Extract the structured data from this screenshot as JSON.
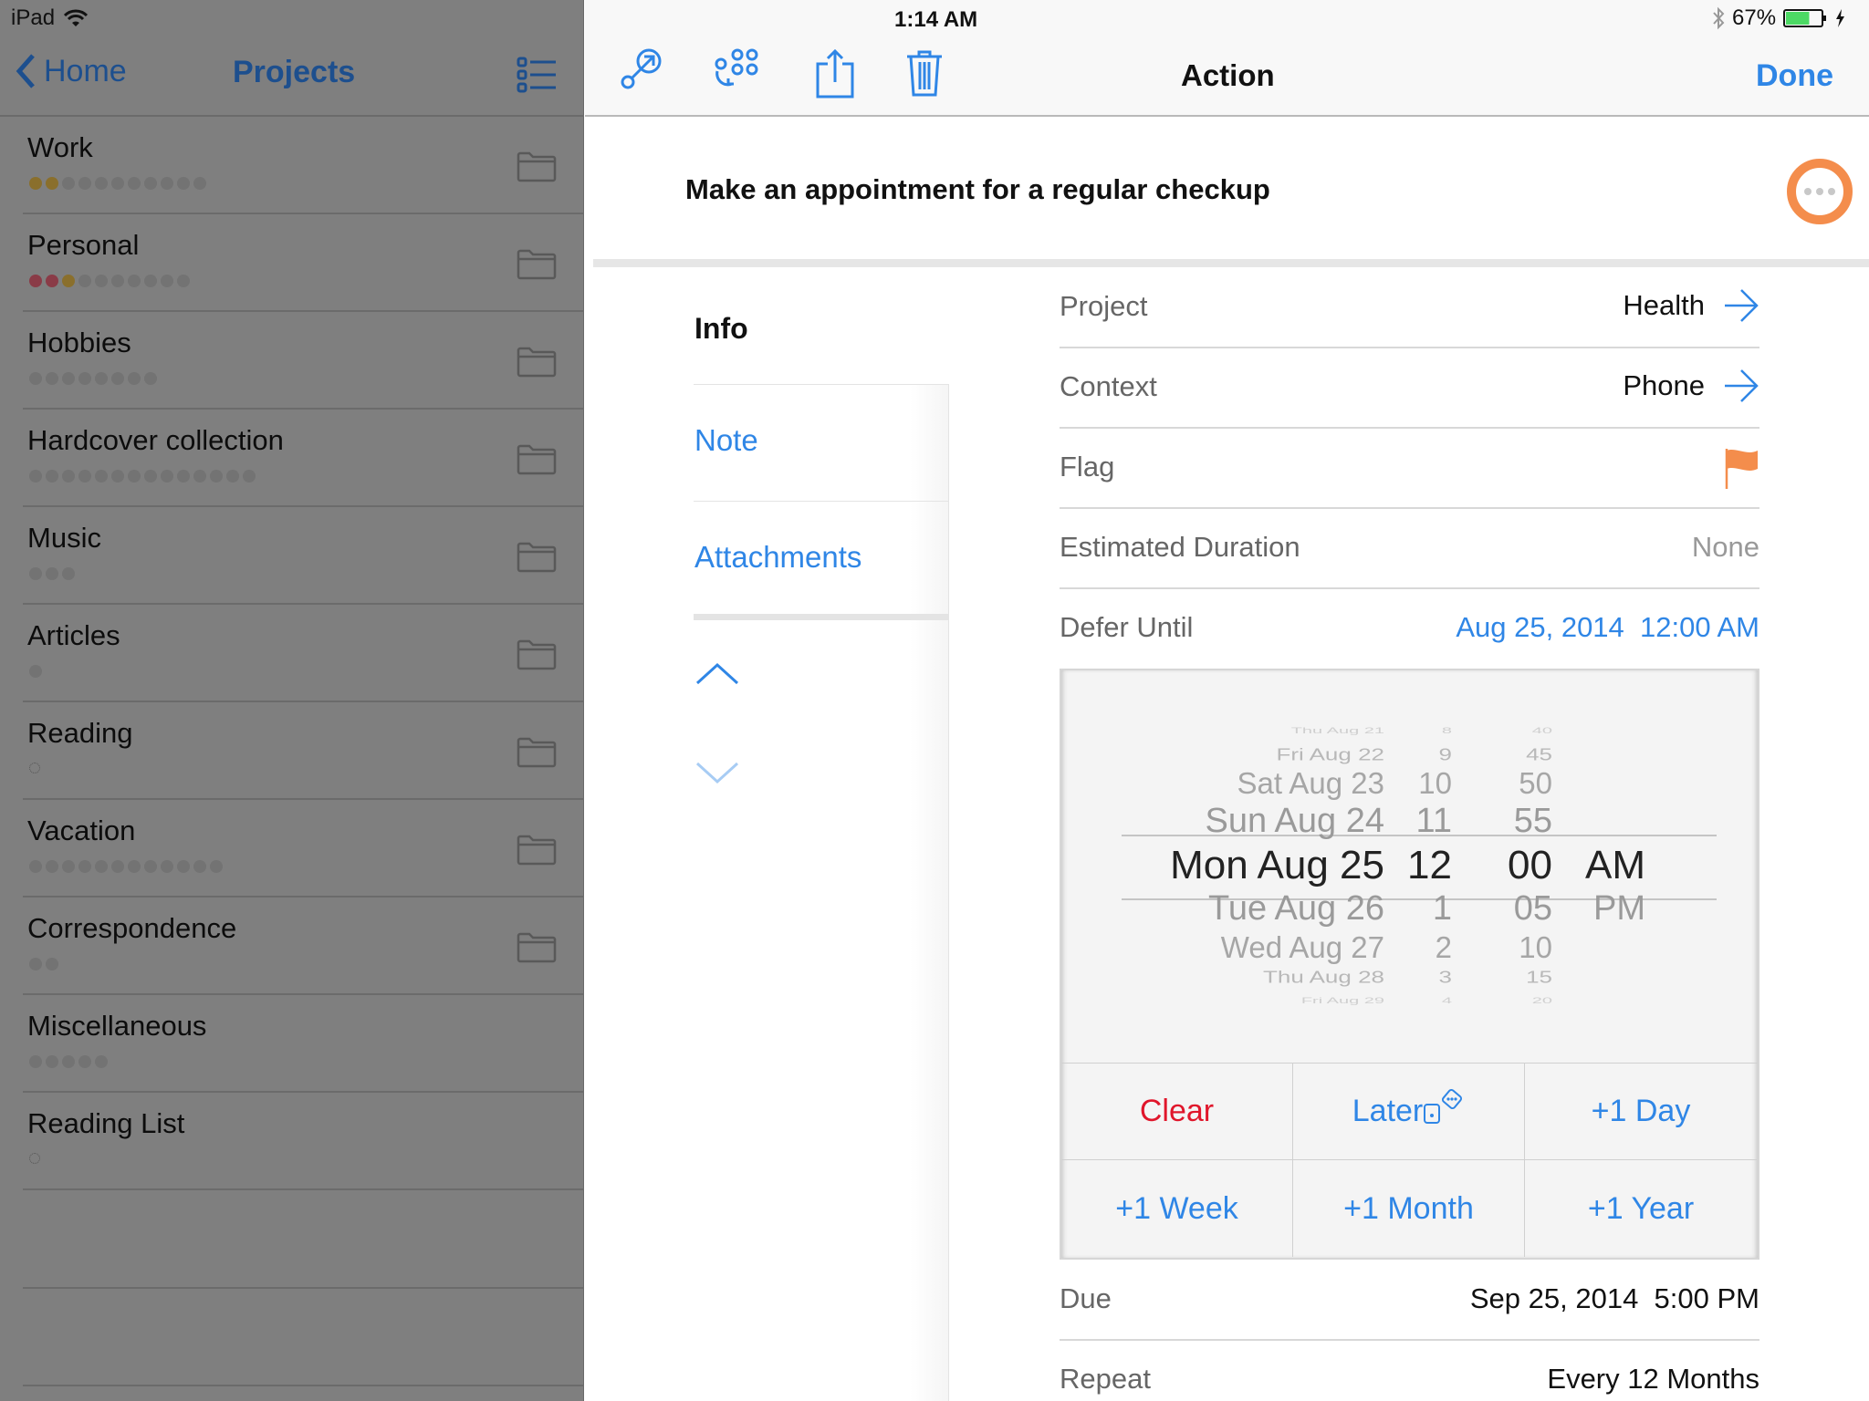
{
  "status_bar": {
    "device": "iPad",
    "time": "1:14 AM",
    "battery": "67%",
    "battery_level": 0.67
  },
  "left_nav": {
    "back_label": "Home",
    "title": "Projects"
  },
  "projects": [
    {
      "name": "Work",
      "dots": [
        "y",
        "y",
        "g",
        "g",
        "g",
        "g",
        "g",
        "g",
        "g",
        "g",
        "g"
      ],
      "folder": true
    },
    {
      "name": "Personal",
      "dots": [
        "r",
        "r",
        "y",
        "g",
        "g",
        "g",
        "g",
        "g",
        "g",
        "g"
      ],
      "folder": true
    },
    {
      "name": "Hobbies",
      "dots": [
        "g",
        "g",
        "g",
        "g",
        "g",
        "g",
        "g",
        "g"
      ],
      "folder": true
    },
    {
      "name": "Hardcover collection",
      "dots": [
        "g",
        "g",
        "g",
        "g",
        "g",
        "g",
        "g",
        "g",
        "g",
        "g",
        "g",
        "g",
        "g",
        "g"
      ],
      "folder": true
    },
    {
      "name": "Music",
      "dots": [
        "g",
        "g",
        "g"
      ],
      "folder": true
    },
    {
      "name": "Articles",
      "dots": [
        "g"
      ],
      "folder": true
    },
    {
      "name": "Reading",
      "dots": [
        "empty"
      ],
      "folder": true
    },
    {
      "name": "Vacation",
      "dots": [
        "g",
        "g",
        "g",
        "g",
        "g",
        "g",
        "g",
        "g",
        "g",
        "g",
        "g",
        "g"
      ],
      "folder": true
    },
    {
      "name": "Correspondence",
      "dots": [
        "g",
        "g"
      ],
      "folder": true
    },
    {
      "name": "Miscellaneous",
      "dots": [
        "g",
        "g",
        "g",
        "g",
        "g"
      ],
      "folder": false
    },
    {
      "name": "Reading List",
      "dots": [
        "empty"
      ],
      "folder": false
    }
  ],
  "toolbar": {
    "title": "Action",
    "done_label": "Done",
    "icons": [
      "focus-icon",
      "group-icon",
      "share-icon",
      "trash-icon"
    ]
  },
  "task": {
    "title": "Make an appointment for a regular checkup"
  },
  "side_tabs": {
    "info": "Info",
    "note": "Note",
    "attachments": "Attachments"
  },
  "fields": {
    "project": {
      "label": "Project",
      "value": "Health"
    },
    "context": {
      "label": "Context",
      "value": "Phone"
    },
    "flag": {
      "label": "Flag",
      "flagged": true
    },
    "duration": {
      "label": "Estimated Duration",
      "value": "None"
    },
    "defer": {
      "label": "Defer Until",
      "value": "Aug 25, 2014  12:00 AM"
    },
    "due": {
      "label": "Due",
      "value": "Sep 25, 2014  5:00 PM"
    },
    "repeat": {
      "label": "Repeat",
      "value": "Every 12 Months"
    }
  },
  "picker": {
    "rows": [
      {
        "date": "Thu Aug 21",
        "hour": "8",
        "minute": "40",
        "ampm": ""
      },
      {
        "date": "Fri Aug 22",
        "hour": "9",
        "minute": "45",
        "ampm": ""
      },
      {
        "date": "Sat Aug 23",
        "hour": "10",
        "minute": "50",
        "ampm": ""
      },
      {
        "date": "Sun Aug 24",
        "hour": "11",
        "minute": "55",
        "ampm": ""
      },
      {
        "date": "Mon Aug 25",
        "hour": "12",
        "minute": "00",
        "ampm": "AM"
      },
      {
        "date": "Tue Aug 26",
        "hour": "1",
        "minute": "05",
        "ampm": "PM"
      },
      {
        "date": "Wed Aug 27",
        "hour": "2",
        "minute": "10",
        "ampm": ""
      },
      {
        "date": "Thu Aug 28",
        "hour": "3",
        "minute": "15",
        "ampm": ""
      },
      {
        "date": "Fri Aug 29",
        "hour": "4",
        "minute": "20",
        "ampm": ""
      }
    ],
    "selected_index": 4
  },
  "quick_buttons": {
    "clear": "Clear",
    "later": "Later",
    "day": "+1 Day",
    "week": "+1 Week",
    "month": "+1 Month",
    "year": "+1 Year"
  },
  "colors": {
    "accent": "#2f86e6",
    "clear": "#e0162b",
    "flag": "#f48d4c"
  }
}
